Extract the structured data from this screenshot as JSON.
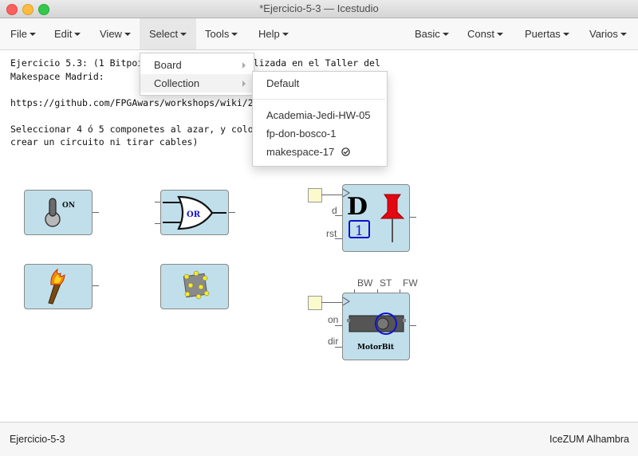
{
  "window": {
    "title": "*Ejercicio-5-3 — Icestudio"
  },
  "menubar": {
    "left": [
      {
        "label": "File"
      },
      {
        "label": "Edit"
      },
      {
        "label": "View"
      },
      {
        "label": "Select"
      },
      {
        "label": "Tools"
      },
      {
        "label": "Help"
      }
    ],
    "right": [
      {
        "label": "Basic"
      },
      {
        "label": "Const"
      },
      {
        "label": "Puertas"
      },
      {
        "label": "Varios"
      }
    ]
  },
  "select_menu": {
    "items": [
      {
        "label": "Board"
      },
      {
        "label": "Collection"
      }
    ]
  },
  "collection_submenu": {
    "default_label": "Default",
    "items": [
      {
        "label": "Academia-Jedi-HW-05"
      },
      {
        "label": "fp-don-bosco-1"
      },
      {
        "label": "makespace-17",
        "checked": true
      }
    ]
  },
  "info_text": {
    "line1": "Ejercicio 5.3: (1 Bitpoint",
    "line1_tail": "ón utilizada en el Taller del",
    "line2": "Makespace Madrid:",
    "line3": "https://github.com/FPGAwars/workshops/wiki/2017_",
    "line4": "Seleccionar 4 ó 5 componetes al azar, y colocarl",
    "line5": "crear un circuito ni tirar cables)"
  },
  "blocks": {
    "switch_label": "ON",
    "or_label": "OR",
    "dff": {
      "letter": "D",
      "init": "1",
      "ports": {
        "d": "d",
        "rst": "rst"
      }
    },
    "motor": {
      "params": {
        "bw": "BW",
        "st": "ST",
        "fw": "FW"
      },
      "ports": {
        "on": "on",
        "dir": "dir"
      },
      "label": "MotorBit"
    }
  },
  "status": {
    "left": "Ejercicio-5-3",
    "right": "IceZUM Alhambra"
  },
  "colors": {
    "block_fill": "#c0dfeb",
    "input_fill": "#fafacc",
    "pin_red": "#e30613",
    "or_blue": "#1010d0"
  }
}
